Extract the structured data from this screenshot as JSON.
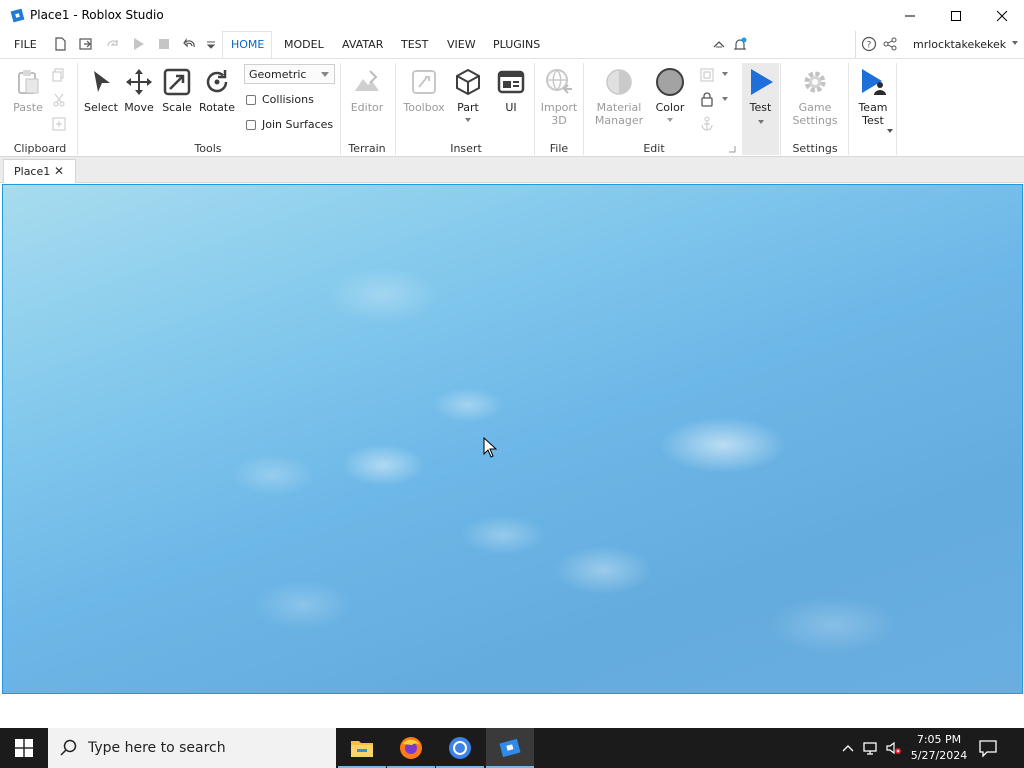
{
  "window": {
    "title": "Place1 - Roblox Studio"
  },
  "menu": {
    "file": "FILE",
    "tabs": [
      "HOME",
      "MODEL",
      "AVATAR",
      "TEST",
      "VIEW",
      "PLUGINS"
    ],
    "active_tab": "HOME",
    "username": "mrlocktakekekek"
  },
  "ribbon": {
    "clipboard": {
      "paste": "Paste",
      "label": "Clipboard"
    },
    "tools": {
      "select": "Select",
      "move": "Move",
      "scale": "Scale",
      "rotate": "Rotate",
      "mode": "Geometric",
      "collisions": "Collisions",
      "join_surfaces": "Join Surfaces",
      "label": "Tools"
    },
    "terrain": {
      "editor": "Editor",
      "label": "Terrain"
    },
    "insert": {
      "toolbox": "Toolbox",
      "part": "Part",
      "ui": "UI",
      "label": "Insert"
    },
    "file": {
      "import_line1": "Import",
      "import_line2": "3D",
      "label": "File"
    },
    "edit": {
      "material_line1": "Material",
      "material_line2": "Manager",
      "color": "Color",
      "label": "Edit"
    },
    "test": {
      "test": "Test"
    },
    "settings": {
      "game_line1": "Game",
      "game_line2": "Settings",
      "label": "Settings"
    },
    "team": {
      "line1": "Team",
      "line2": "Test"
    }
  },
  "document_tab": {
    "name": "Place1"
  },
  "taskbar": {
    "search_placeholder": "Type here to search",
    "time": "7:05 PM",
    "date": "5/27/2024"
  },
  "colors": {
    "accent": "#1e9be0",
    "test_blue": "#1e6fd9",
    "taskbar": "#1b1b1b"
  }
}
